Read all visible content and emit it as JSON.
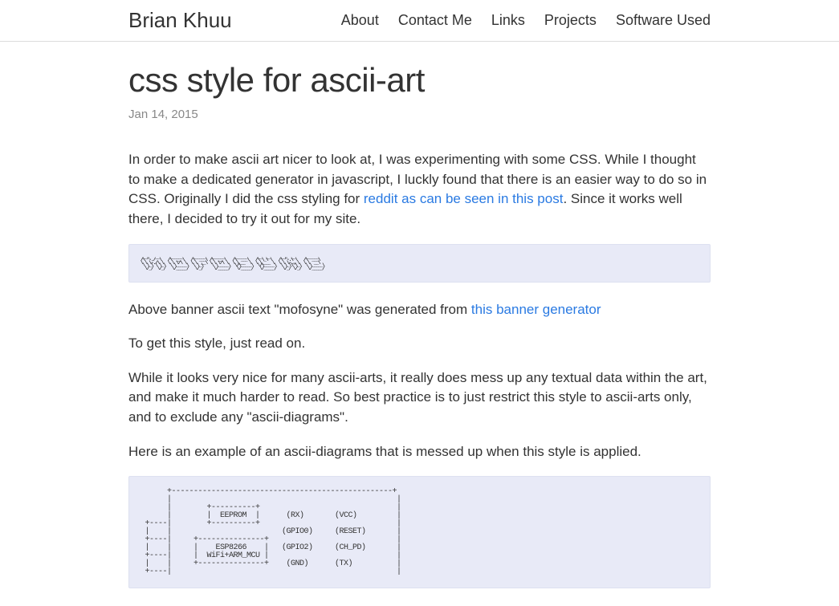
{
  "site": {
    "title": "Brian Khuu"
  },
  "nav": {
    "items": [
      {
        "label": "About"
      },
      {
        "label": "Contact Me"
      },
      {
        "label": "Links"
      },
      {
        "label": "Projects"
      },
      {
        "label": "Software Used"
      }
    ]
  },
  "article": {
    "title": "css style for ascii-art",
    "date": "Jan 14, 2015",
    "intro_before_link": "In order to make ascii art nicer to look at, I was experimenting with some CSS. While I thought to make a dedicated generator in javascript, I luckly found that there is an easier way to do so in CSS. Originally I did the css styling for ",
    "intro_link": "reddit as can be seen in this post",
    "intro_after_link": ". Since it works well there, I decided to try it out for my site.",
    "banner_ascii": " __    __     ______     ______   ______     ______     __  __     __   __     ______    \n/\\ \"-./  \\   /\\  __ \\   /\\  ___\\ /\\  __ \\   /\\  ___\\   /\\ \\_\\ \\   /\\ \"-.\\ \\   /\\  ___\\   \n\\ \\ \\-./\\ \\  \\ \\ \\/\\ \\  \\ \\  __\\ \\ \\ \\/\\ \\  \\ \\___  \\  \\ \\____ \\  \\ \\ \\-.  \\  \\ \\  __\\   \n \\ \\_\\ \\ \\_\\  \\ \\_____\\  \\ \\_\\    \\ \\_____\\  \\/\\_____\\  \\/\\_____\\  \\ \\_\\\\\"\\_\\  \\ \\_____\\ \n  \\/_/  \\/_/   \\/_____/   \\/_/     \\/_____/   \\/_____/   \\/_____/   \\/_/ \\/_/   \\/_____/ ",
    "banner_caption_before": "Above banner ascii text \"mofosyne\" was generated from ",
    "banner_caption_link": "this banner generator",
    "style_note": "To get this style, just read on.",
    "warning": "While it looks very nice for many ascii-arts, it really does mess up any textual data within the art, and make it much harder to read. So best practice is to just restrict this style to ascii-arts only, and to exclude any \"ascii-diagrams\".",
    "diagram_intro": "Here is an example of an ascii-diagrams that is messed up when this style is applied.",
    "diagram_ascii": "      +--------------------------------------------------+\n      |                                                   |\n      |        +----------+                               |\n      |        |  EEPROM  |      (RX)       (VCC)         |\n +----|        +----------+                               |\n |    |                         (GPIO0)     (RESET)       |\n +----|     +---------------+                             |\n |    |     |    ESP8266    |   (GPIO2)     (CH_PD)       |\n +----|     |  WiFi+ARM_MCU |                             |\n |    |     +---------------+    (GND)      (TX)          |\n +----|                                                   |"
  }
}
